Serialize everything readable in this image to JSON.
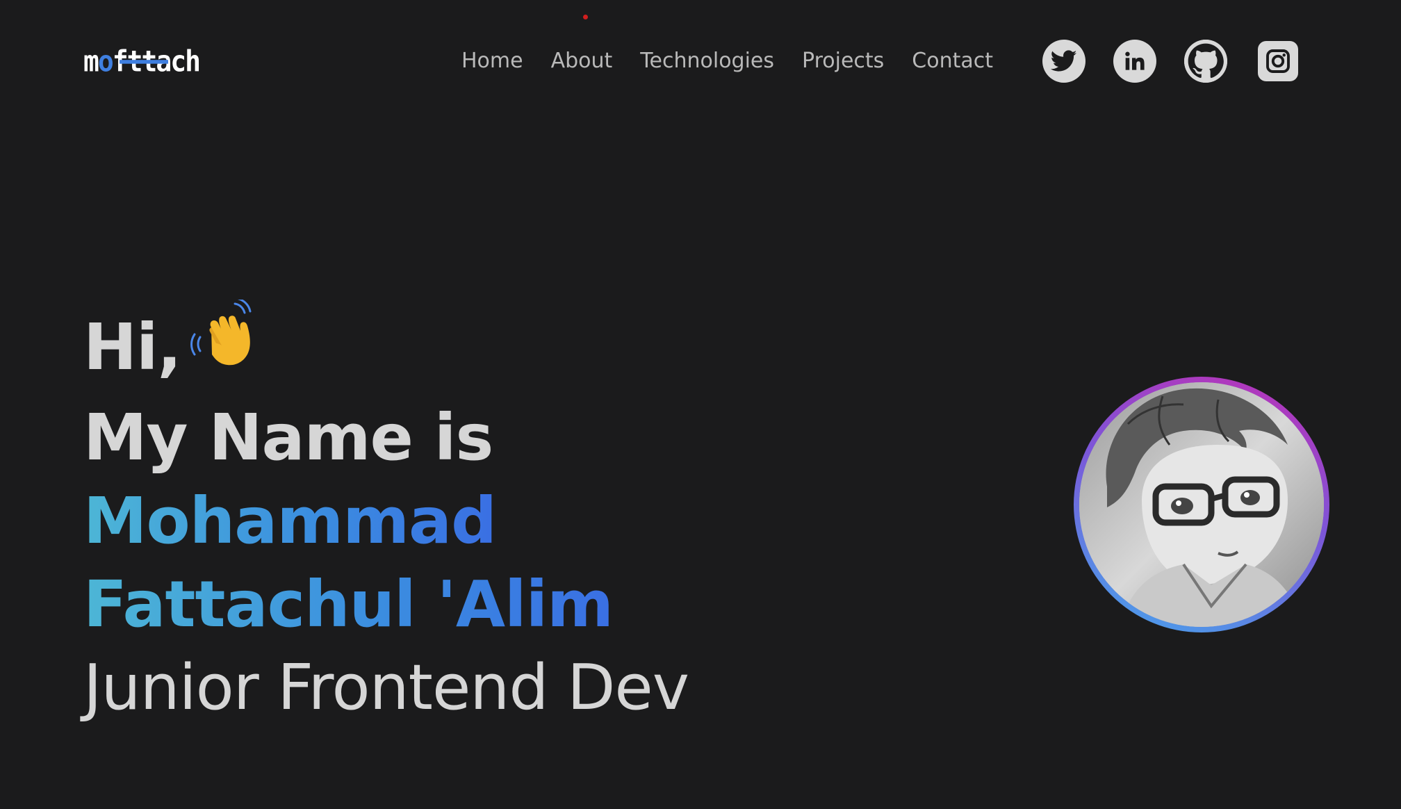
{
  "header": {
    "logo_text_prefix": "m",
    "logo_text_accent": "o",
    "logo_text_suffix": "fttach",
    "nav": [
      {
        "label": "Home"
      },
      {
        "label": "About"
      },
      {
        "label": "Technologies"
      },
      {
        "label": "Projects"
      },
      {
        "label": "Contact"
      }
    ],
    "socials": [
      {
        "icon": "twitter-icon"
      },
      {
        "icon": "linkedin-icon"
      },
      {
        "icon": "github-icon"
      },
      {
        "icon": "instagram-icon"
      }
    ]
  },
  "hero": {
    "greeting": "Hi,",
    "wave_icon": "waving-hand-icon",
    "intro": "My Name is",
    "name_line1": "Mohammad",
    "name_line2": "Fattachul 'Alim",
    "role": "Junior Frontend Dev"
  },
  "colors": {
    "background": "#1b1b1c",
    "text": "#d6d6d6",
    "nav_text": "#b9b9b9",
    "accent_blue": "#3f7fe0",
    "name_gradient_start": "#4db6d6",
    "name_gradient_end": "#3a6fe3",
    "avatar_ring_top": "#c02fb4",
    "avatar_ring_bottom": "#45a6ec"
  }
}
